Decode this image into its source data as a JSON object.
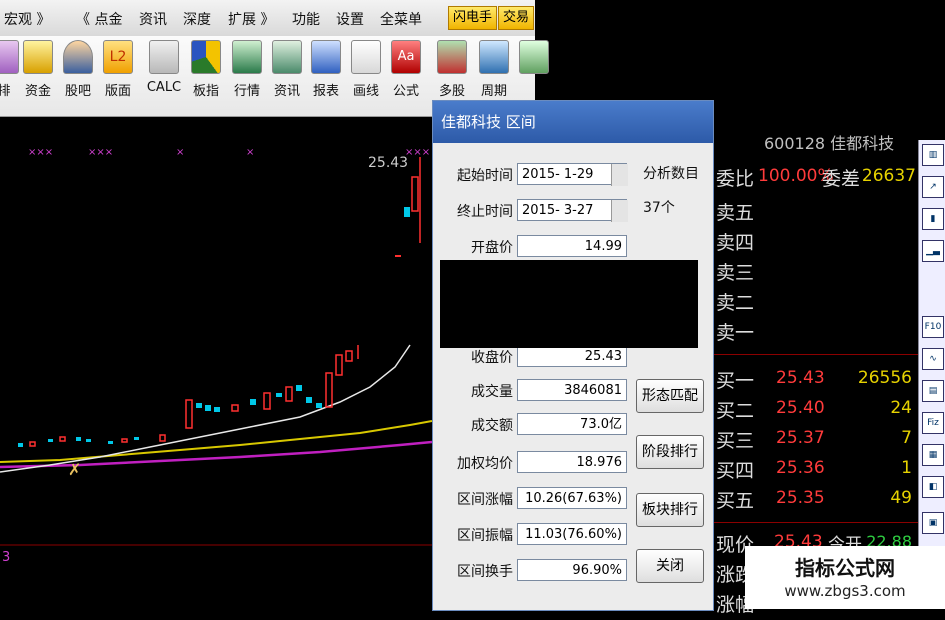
{
  "menubar": {
    "items": [
      "宏观 》",
      "《 点金",
      "资讯",
      "深度",
      "扩展 》",
      "功能",
      "设置",
      "全菜单"
    ],
    "flash_label": "闪电手",
    "trade_label": "交易"
  },
  "toolbar": {
    "items": [
      {
        "label": "排",
        "icon": "rank-icon"
      },
      {
        "label": "资金",
        "icon": "money-bag-icon"
      },
      {
        "label": "股吧",
        "icon": "people-icon"
      },
      {
        "label": "L2",
        "icon_text": "L2",
        "icon": "l2-icon"
      },
      {
        "label": "版面",
        "icon": "layout-icon"
      },
      {
        "label": "CALC",
        "icon": "calculator-icon"
      },
      {
        "label": "板指",
        "icon": "pie-chart-icon"
      },
      {
        "label": "行情",
        "icon": "quote-icon"
      },
      {
        "label": "资讯",
        "icon": "news-icon"
      },
      {
        "label": "报表",
        "icon": "report-icon"
      },
      {
        "label": "画线",
        "icon": "draw-line-icon"
      },
      {
        "label": "公式",
        "icon_text": "Aa",
        "icon": "formula-icon"
      },
      {
        "label": "多股",
        "icon": "multi-stock-icon"
      },
      {
        "label": "周期",
        "icon": "period-icon"
      }
    ]
  },
  "chart": {
    "price_label": "25.43",
    "bottom_label": "3"
  },
  "dialog": {
    "title": "佳都科技  区间",
    "start_label": "起始时间",
    "start_value": "2015- 1-29",
    "end_label": "终止时间",
    "end_value": "2015- 3-27",
    "count_label": "分析数目",
    "count_value": "37个",
    "open_label": "开盘价",
    "open_value": "14.99",
    "close_label": "收盘价",
    "close_value": "25.43",
    "volume_label": "成交量",
    "volume_value": "3846081",
    "amount_label": "成交额",
    "amount_value": "73.0亿",
    "wavg_label": "加权均价",
    "wavg_value": "18.976",
    "rise_label": "区间涨幅",
    "rise_value": "10.26(67.63%)",
    "amp_label": "区间振幅",
    "amp_value": "11.03(76.60%)",
    "turnover_label": "区间换手",
    "turnover_value": "96.90%",
    "btn_pattern": "形态匹配",
    "btn_stage": "阶段排行",
    "btn_sector": "板块排行",
    "btn_close": "关闭"
  },
  "rightpanel": {
    "header": "600128 佳都科技",
    "weibi_label": "委比",
    "weibi_value": "100.00%",
    "weicha_label": "委差",
    "weicha_value": "26637",
    "sell": [
      "卖五",
      "卖四",
      "卖三",
      "卖二",
      "卖一"
    ],
    "buy": [
      {
        "label": "买一",
        "price": "25.43",
        "vol": "26556"
      },
      {
        "label": "买二",
        "price": "25.40",
        "vol": "24"
      },
      {
        "label": "买三",
        "price": "25.37",
        "vol": "7"
      },
      {
        "label": "买四",
        "price": "25.36",
        "vol": "1"
      },
      {
        "label": "买五",
        "price": "25.35",
        "vol": "49"
      }
    ],
    "now_label": "现价",
    "now_value": "25.43",
    "open_label": "今开",
    "open_value": "22.88",
    "change_label": "涨跌",
    "range_label": "涨幅"
  },
  "watermark": {
    "line1": "指标公式网",
    "line2": "www.zbgs3.com"
  }
}
